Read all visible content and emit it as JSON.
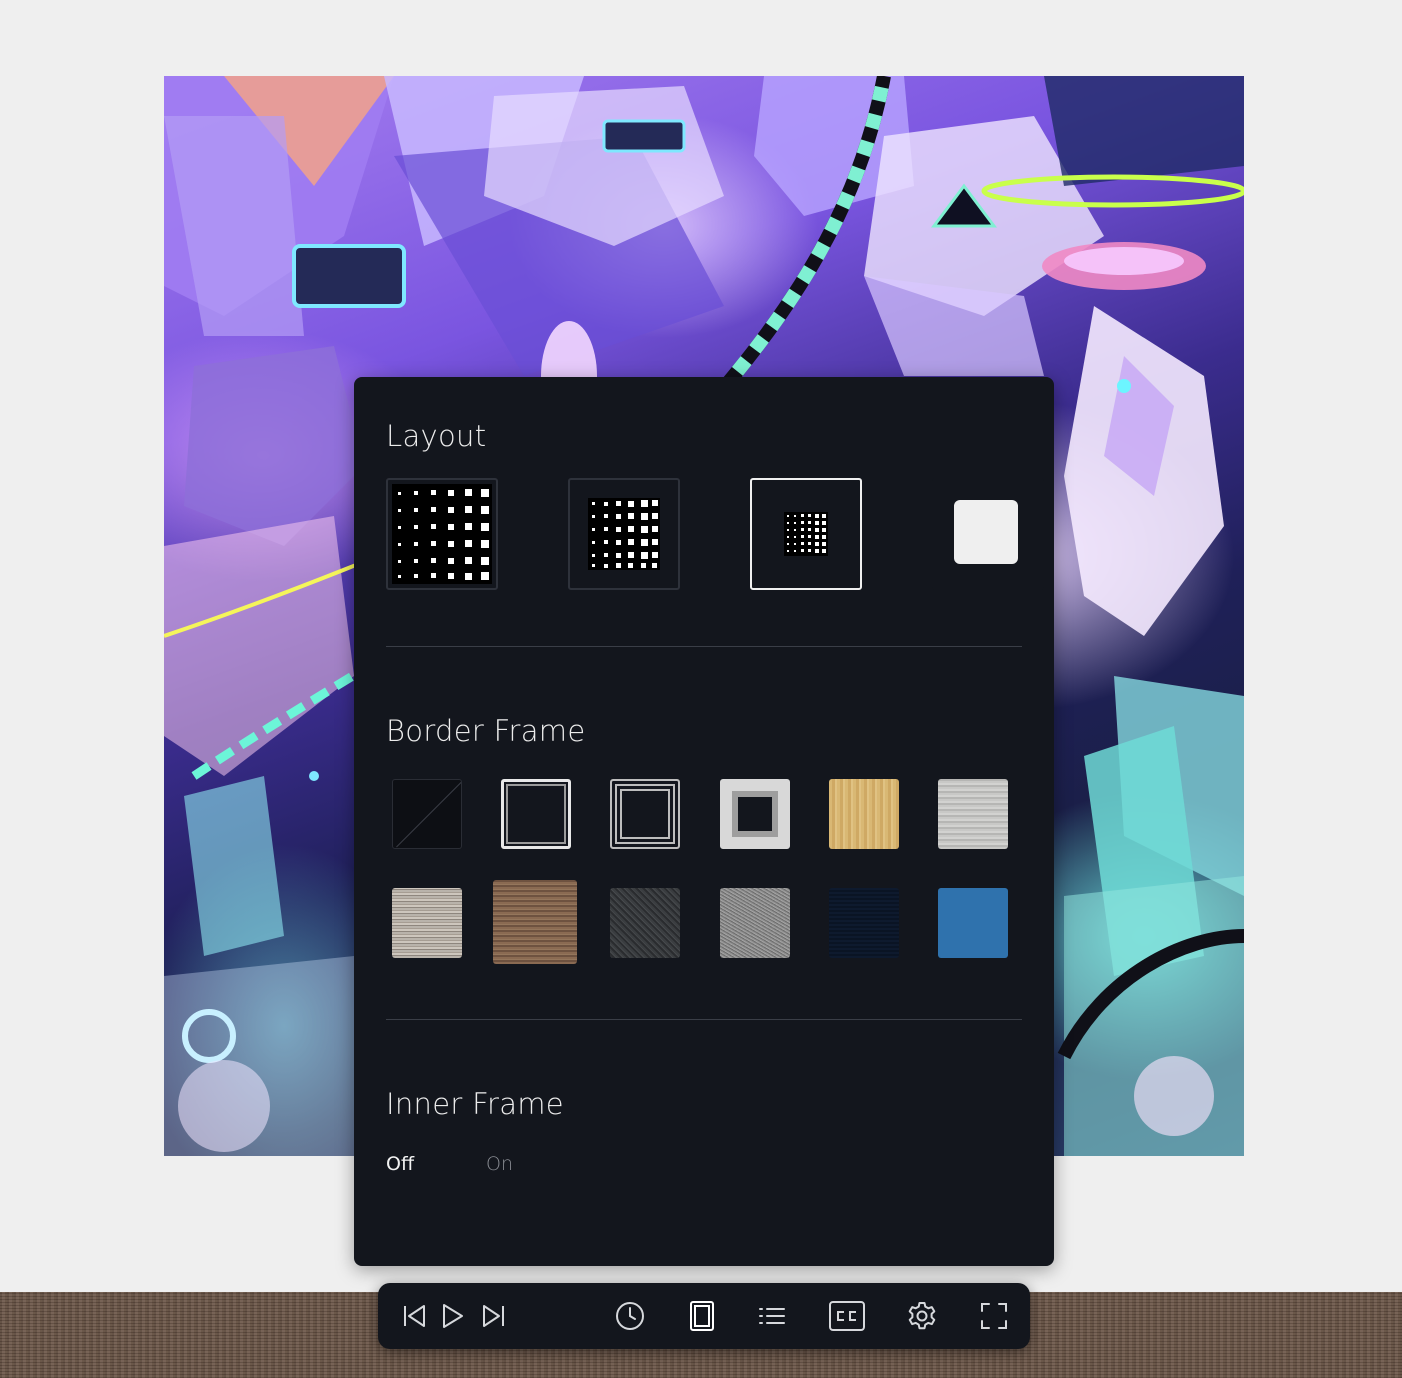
{
  "panel": {
    "layout_title": "Layout",
    "border_frame_title": "Border Frame",
    "inner_frame_title": "Inner Frame",
    "inner_frame_options": {
      "off": "Off",
      "on": "On"
    },
    "inner_frame_selected": "Off",
    "layout_selected_index": 2,
    "border_frames": [
      "none",
      "thin-silver",
      "multi-line",
      "white-mat",
      "oak",
      "whitewash",
      "driftwood",
      "walnut",
      "charcoal",
      "granite",
      "navy",
      "blue"
    ]
  },
  "controls": [
    "skip-previous-icon",
    "play-icon",
    "skip-next-icon",
    "clock-icon",
    "frame-icon",
    "playlist-icon",
    "captions-icon",
    "settings-icon",
    "fullscreen-icon"
  ],
  "colors": {
    "panel_bg": "#13161d",
    "wall": "#efefef",
    "selected_border": "#f0f0f0",
    "text_primary": "#ececec",
    "text_muted": "#8a8d94"
  }
}
